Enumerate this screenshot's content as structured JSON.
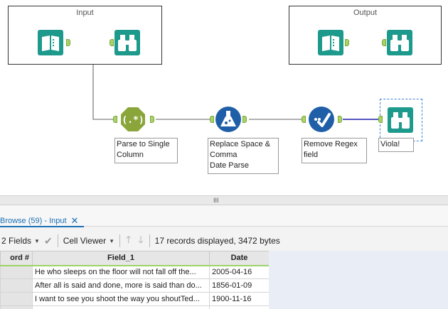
{
  "canvas": {
    "containers": [
      {
        "title": "Input"
      },
      {
        "title": "Output"
      }
    ],
    "annotations": {
      "parse": [
        "Parse to Single",
        "Column"
      ],
      "replace": [
        "Replace Space &",
        "Comma",
        "Date Parse"
      ],
      "regex": [
        "Remove Regex",
        "field"
      ],
      "browse": [
        "Viola!"
      ]
    },
    "colors": {
      "teal": "#1d9a8c",
      "regex_green": "#8aa63a",
      "formula_blue": "#1f5fa8",
      "anchor_green": "#a8d36a",
      "wire": "#808080",
      "wire_selected": "#1c1ca8"
    },
    "icons": {
      "input": "book-input-icon",
      "browse": "binoculars-icon",
      "regex": "regex-octagon-icon",
      "formula": "flask-icon",
      "select": "checkmark-circle-icon"
    }
  },
  "splitter": {
    "grip": "III"
  },
  "results": {
    "tab": {
      "label": "Browse (59) - Input",
      "close": "✕"
    },
    "toolbar": {
      "fields": "2 Fields",
      "viewer": "Cell Viewer",
      "status": "17 records displayed, 3472 bytes"
    },
    "table": {
      "columns": [
        "ord #",
        "Field_1",
        "Date"
      ],
      "rows": [
        [
          "",
          "He who sleeps on the floor will not fall off the...",
          "2005-04-16"
        ],
        [
          "",
          "After all is said and done, more is said than do...",
          "1856-01-09"
        ],
        [
          "",
          "I want to see you shoot the way you shoutTed...",
          "1900-11-16"
        ],
        [
          "",
          "...",
          "..."
        ]
      ]
    }
  }
}
